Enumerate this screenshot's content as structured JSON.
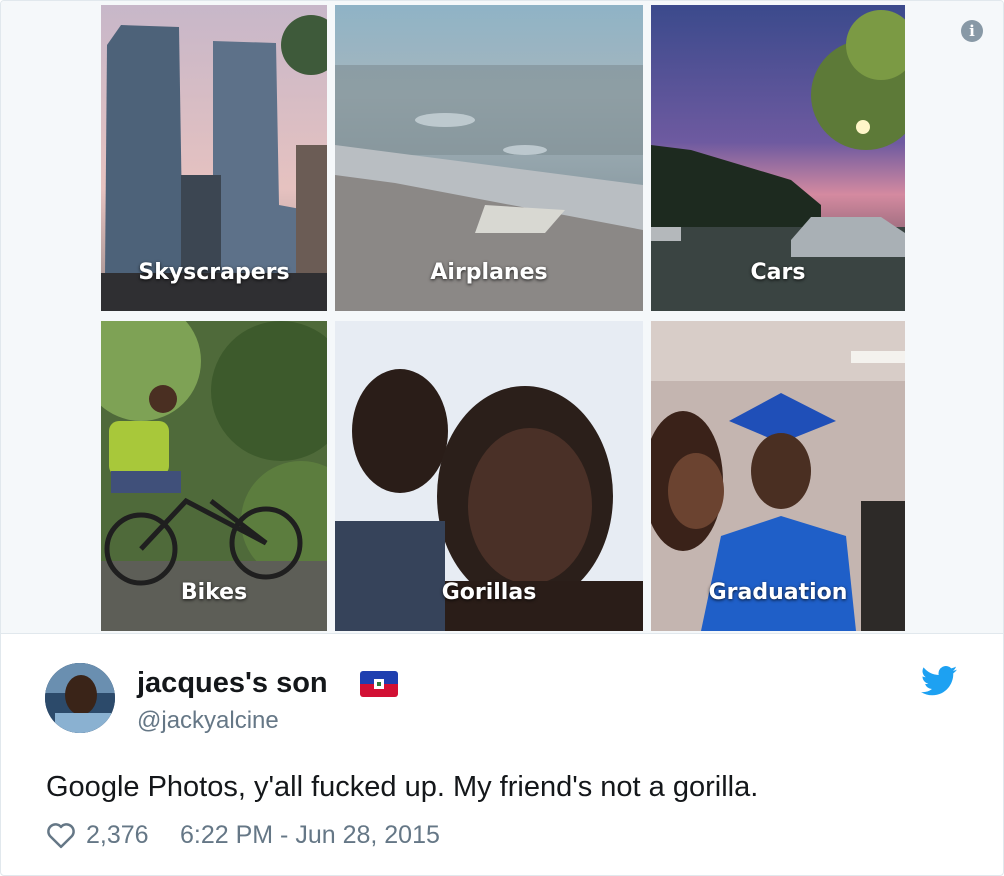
{
  "media": {
    "info_icon": "info-icon",
    "tiles": [
      {
        "label": "Skyscrapers"
      },
      {
        "label": "Airplanes"
      },
      {
        "label": "Cars"
      },
      {
        "label": "Bikes"
      },
      {
        "label": "Gorillas"
      },
      {
        "label": "Graduation"
      }
    ]
  },
  "author": {
    "name": "jacques's son",
    "flag_icon": "haiti-flag-icon",
    "handle": "@jackyalcine",
    "platform_icon": "twitter-bird-icon"
  },
  "tweet": {
    "text": "Google Photos, y'all fucked up. My friend's not a gorilla.",
    "likes": "2,376",
    "timestamp": "6:22 PM - Jun 28, 2015"
  },
  "colors": {
    "twitter_blue": "#1da1f2",
    "text_primary": "#14171a",
    "text_secondary": "#657786"
  }
}
